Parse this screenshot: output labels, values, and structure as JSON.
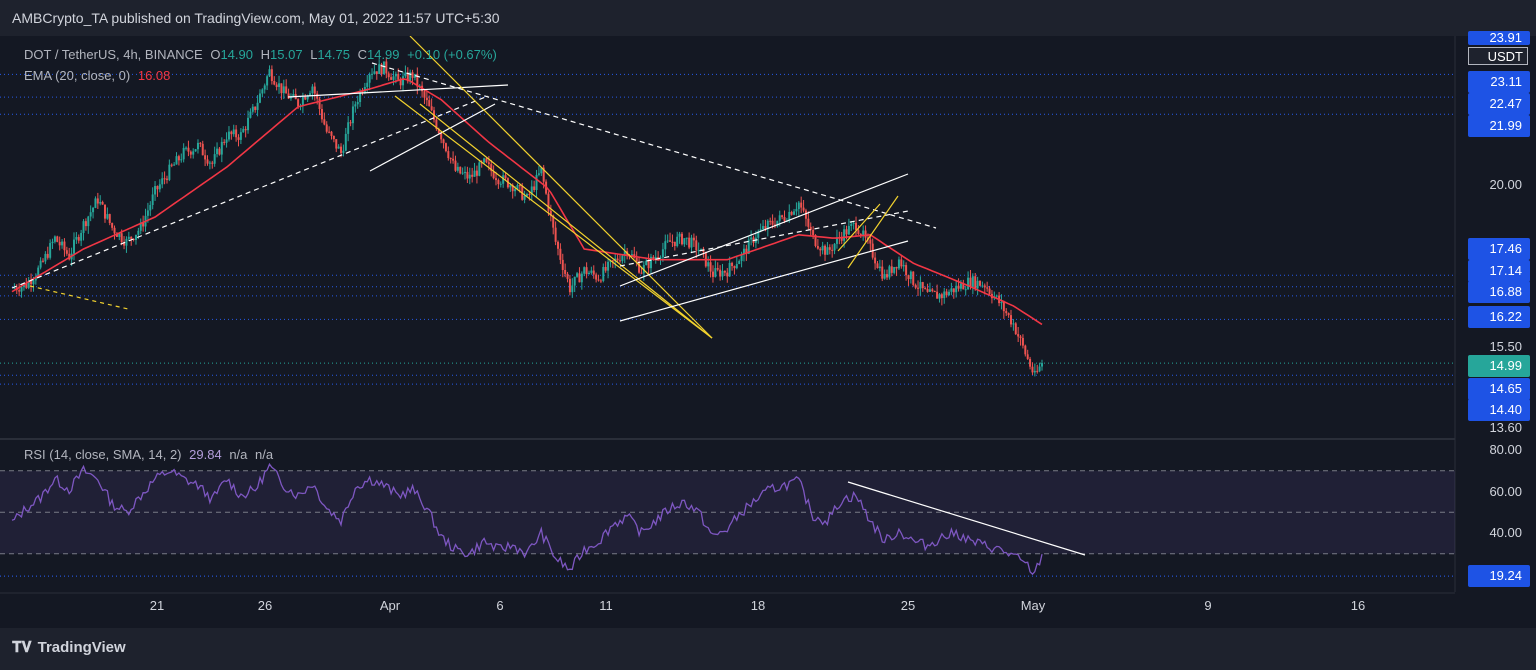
{
  "header": {
    "publisher": "AMBCrypto_TA published on TradingView.com, May 01, 2022 11:57 UTC+5:30"
  },
  "footer": {
    "brand": "TradingView",
    "brand_icon": "tradingview-logo-icon"
  },
  "legend": {
    "symbol": "DOT / TetherUS, 4h, BINANCE",
    "o_label": "O",
    "o_value": "14.90",
    "h_label": "H",
    "h_value": "15.07",
    "l_label": "L",
    "l_value": "14.75",
    "c_label": "C",
    "c_value": "14.99",
    "change": "+0.10 (+0.67%)",
    "ema_label": "EMA (20, close, 0)",
    "ema_value": "16.08",
    "rsi_label": "RSI (14, close, SMA, 14, 2)",
    "rsi_value": "29.84",
    "rsi_na1": "n/a",
    "rsi_na2": "n/a"
  },
  "price_axis": {
    "currency": "USDT",
    "top_partial": "23.91",
    "labels": [
      "20.00",
      "15.50",
      "13.60"
    ],
    "pills": [
      "23.11",
      "22.47",
      "21.99",
      "17.46",
      "17.14",
      "16.88",
      "16.22",
      "14.65",
      "14.40"
    ],
    "last_price": "14.99"
  },
  "rsi_axis": {
    "labels": [
      "80.00",
      "60.00",
      "40.00"
    ],
    "pill": "19.24"
  },
  "time_axis": [
    "21",
    "26",
    "Apr",
    "6",
    "11",
    "18",
    "25",
    "May",
    "9",
    "16"
  ],
  "colors": {
    "background": "#141823",
    "up": "#26a69a",
    "down": "#ef5350",
    "ema": "#f23645",
    "rsi": "#7e57c2",
    "channel_yellow": "#f2d22e",
    "pill_blue": "#1e53e5",
    "last_price": "#26a69a"
  },
  "chart_data": [
    {
      "type": "candlestick",
      "title": "DOT / TetherUS, 4h, BINANCE",
      "x_ticks": [
        "21",
        "26",
        "Apr",
        "6",
        "11",
        "18",
        "25",
        "May",
        "9",
        "16"
      ],
      "y_ticks": [
        "20.00",
        "15.50",
        "13.60"
      ],
      "ylim": [
        13.2,
        24.3
      ],
      "close_path": [
        [
          0,
          17.1
        ],
        [
          6,
          17.2
        ],
        [
          12,
          17.7
        ],
        [
          18,
          18.5
        ],
        [
          24,
          18.0
        ],
        [
          30,
          18.9
        ],
        [
          36,
          19.6
        ],
        [
          42,
          18.8
        ],
        [
          48,
          18.4
        ],
        [
          54,
          18.8
        ],
        [
          60,
          19.8
        ],
        [
          66,
          20.4
        ],
        [
          72,
          20.9
        ],
        [
          78,
          21.1
        ],
        [
          84,
          20.6
        ],
        [
          90,
          21.4
        ],
        [
          96,
          21.4
        ],
        [
          102,
          22.2
        ],
        [
          108,
          23.2
        ],
        [
          114,
          22.6
        ],
        [
          120,
          22.3
        ],
        [
          126,
          22.8
        ],
        [
          132,
          21.5
        ],
        [
          138,
          20.9
        ],
        [
          144,
          22.3
        ],
        [
          150,
          23.2
        ],
        [
          156,
          23.3
        ],
        [
          162,
          22.9
        ],
        [
          168,
          23.1
        ],
        [
          174,
          22.3
        ],
        [
          180,
          21.4
        ],
        [
          186,
          20.4
        ],
        [
          192,
          20.2
        ],
        [
          198,
          20.6
        ],
        [
          204,
          20.2
        ],
        [
          210,
          20.0
        ],
        [
          216,
          19.6
        ],
        [
          222,
          20.4
        ],
        [
          228,
          18.4
        ],
        [
          234,
          17.1
        ],
        [
          240,
          17.6
        ],
        [
          246,
          17.4
        ],
        [
          252,
          17.8
        ],
        [
          258,
          18.2
        ],
        [
          264,
          17.6
        ],
        [
          270,
          18.0
        ],
        [
          276,
          18.4
        ],
        [
          282,
          18.5
        ],
        [
          288,
          18.2
        ],
        [
          294,
          17.5
        ],
        [
          300,
          17.6
        ],
        [
          306,
          18.0
        ],
        [
          312,
          18.6
        ],
        [
          318,
          18.9
        ],
        [
          324,
          19.1
        ],
        [
          330,
          19.5
        ],
        [
          336,
          18.5
        ],
        [
          342,
          18.1
        ],
        [
          348,
          18.6
        ],
        [
          354,
          18.9
        ],
        [
          360,
          18.2
        ],
        [
          366,
          17.4
        ],
        [
          372,
          17.9
        ],
        [
          378,
          17.3
        ],
        [
          384,
          16.9
        ],
        [
          390,
          16.9
        ],
        [
          396,
          17.1
        ],
        [
          402,
          17.3
        ],
        [
          408,
          17.2
        ],
        [
          414,
          16.7
        ],
        [
          420,
          16.1
        ],
        [
          426,
          15.1
        ],
        [
          429,
          14.6
        ],
        [
          432,
          14.99
        ]
      ],
      "ema": {
        "name": "EMA (20, close, 0)",
        "last": 16.08,
        "path": [
          [
            0,
            17.0
          ],
          [
            30,
            18.2
          ],
          [
            60,
            19.1
          ],
          [
            90,
            20.5
          ],
          [
            120,
            22.2
          ],
          [
            150,
            22.7
          ],
          [
            165,
            23.0
          ],
          [
            180,
            22.4
          ],
          [
            200,
            21.2
          ],
          [
            225,
            19.9
          ],
          [
            240,
            18.2
          ],
          [
            270,
            17.9
          ],
          [
            300,
            17.9
          ],
          [
            330,
            18.6
          ],
          [
            345,
            18.5
          ],
          [
            360,
            18.6
          ],
          [
            378,
            17.8
          ],
          [
            400,
            17.2
          ],
          [
            420,
            16.6
          ],
          [
            432,
            16.08
          ]
        ]
      },
      "horizontal_levels": [
        23.11,
        22.47,
        21.99,
        17.46,
        17.14,
        16.88,
        16.22,
        14.65,
        14.4
      ],
      "last_price": 14.99
    },
    {
      "type": "line",
      "title": "RSI (14, close, SMA, 14, 2)",
      "y_ticks": [
        "80.00",
        "60.00",
        "40.00"
      ],
      "ylim": [
        15,
        85
      ],
      "bands": [
        70,
        50,
        30
      ],
      "current": 29.84,
      "min_level": 19.24,
      "series": [
        {
          "values": [
            [
              0,
              45
            ],
            [
              6,
              52
            ],
            [
              12,
              57
            ],
            [
              18,
              66
            ],
            [
              24,
              61
            ],
            [
              30,
              70
            ],
            [
              36,
              66
            ],
            [
              42,
              54
            ],
            [
              48,
              50
            ],
            [
              54,
              58
            ],
            [
              60,
              66
            ],
            [
              66,
              70
            ],
            [
              72,
              66
            ],
            [
              78,
              63
            ],
            [
              84,
              56
            ],
            [
              90,
              66
            ],
            [
              96,
              58
            ],
            [
              102,
              61
            ],
            [
              108,
              72
            ],
            [
              114,
              63
            ],
            [
              120,
              58
            ],
            [
              126,
              64
            ],
            [
              132,
              52
            ],
            [
              138,
              46
            ],
            [
              144,
              62
            ],
            [
              150,
              66
            ],
            [
              156,
              63
            ],
            [
              162,
              58
            ],
            [
              168,
              61
            ],
            [
              174,
              52
            ],
            [
              180,
              38
            ],
            [
              186,
              32
            ],
            [
              192,
              30
            ],
            [
              198,
              36
            ],
            [
              204,
              32
            ],
            [
              210,
              34
            ],
            [
              216,
              30
            ],
            [
              222,
              40
            ],
            [
              228,
              28
            ],
            [
              234,
              22
            ],
            [
              240,
              32
            ],
            [
              246,
              36
            ],
            [
              252,
              44
            ],
            [
              258,
              48
            ],
            [
              264,
              40
            ],
            [
              270,
              46
            ],
            [
              276,
              52
            ],
            [
              282,
              55
            ],
            [
              288,
              50
            ],
            [
              294,
              38
            ],
            [
              300,
              42
            ],
            [
              306,
              50
            ],
            [
              312,
              56
            ],
            [
              318,
              61
            ],
            [
              324,
              63
            ],
            [
              330,
              65
            ],
            [
              336,
              48
            ],
            [
              342,
              46
            ],
            [
              348,
              56
            ],
            [
              354,
              58
            ],
            [
              360,
              46
            ],
            [
              366,
              36
            ],
            [
              372,
              41
            ],
            [
              378,
              36
            ],
            [
              384,
              34
            ],
            [
              390,
              38
            ],
            [
              396,
              40
            ],
            [
              402,
              36
            ],
            [
              408,
              34
            ],
            [
              414,
              32
            ],
            [
              420,
              29
            ],
            [
              426,
              24
            ],
            [
              429,
              20
            ],
            [
              432,
              29.84
            ]
          ]
        }
      ]
    }
  ]
}
